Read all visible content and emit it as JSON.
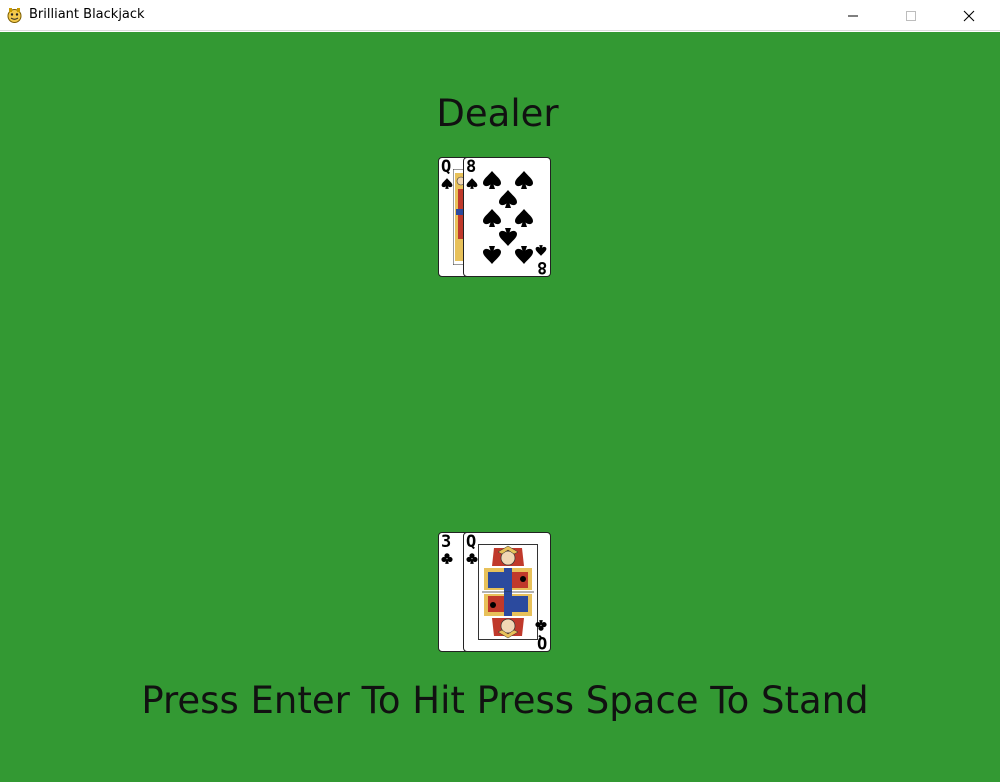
{
  "window": {
    "title": "Brilliant Blackjack",
    "icon": "pygame-snake-icon"
  },
  "table": {
    "background_color": "#339933",
    "dealer_label": "Dealer",
    "prompt": "Press Enter To Hit Press Space To Stand"
  },
  "dealer_hand": {
    "cards": [
      {
        "rank": "Q",
        "suit": "spades"
      },
      {
        "rank": "8",
        "suit": "spades"
      }
    ]
  },
  "player_hand": {
    "cards": [
      {
        "rank": "3",
        "suit": "clubs"
      },
      {
        "rank": "Q",
        "suit": "clubs"
      }
    ]
  }
}
